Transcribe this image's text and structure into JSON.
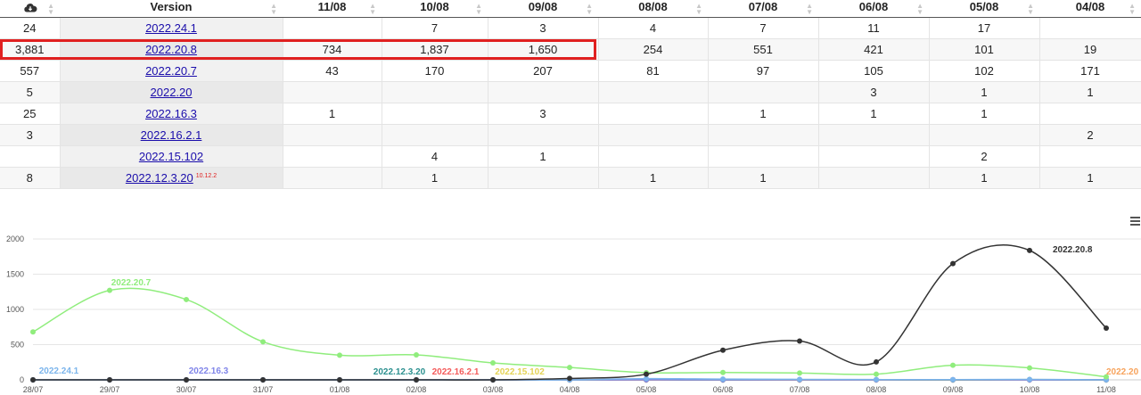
{
  "table": {
    "download_icon": "cloud-download-icon",
    "headers": [
      "Version",
      "11/08",
      "10/08",
      "09/08",
      "08/08",
      "07/08",
      "06/08",
      "05/08",
      "04/08"
    ],
    "rows": [
      {
        "total": "24",
        "version": "2022.24.1",
        "sup": "",
        "cells": [
          "",
          "7",
          "3",
          "4",
          "7",
          "11",
          "17",
          ""
        ]
      },
      {
        "total": "3,881",
        "version": "2022.20.8",
        "sup": "",
        "cells": [
          "734",
          "1,837",
          "1,650",
          "254",
          "551",
          "421",
          "101",
          "19"
        ]
      },
      {
        "total": "557",
        "version": "2022.20.7",
        "sup": "",
        "cells": [
          "43",
          "170",
          "207",
          "81",
          "97",
          "105",
          "102",
          "171"
        ]
      },
      {
        "total": "5",
        "version": "2022.20",
        "sup": "",
        "cells": [
          "",
          "",
          "",
          "",
          "",
          "3",
          "1",
          "1"
        ]
      },
      {
        "total": "25",
        "version": "2022.16.3",
        "sup": "",
        "cells": [
          "1",
          "",
          "3",
          "",
          "1",
          "1",
          "1",
          ""
        ]
      },
      {
        "total": "3",
        "version": "2022.16.2.1",
        "sup": "",
        "cells": [
          "",
          "",
          "",
          "",
          "",
          "",
          "",
          "2"
        ]
      },
      {
        "total": "",
        "version": "2022.15.102",
        "sup": "",
        "cells": [
          "",
          "4",
          "1",
          "",
          "",
          "",
          "2",
          ""
        ]
      },
      {
        "total": "8",
        "version": "2022.12.3.20",
        "sup": "10.12.2",
        "cells": [
          "",
          "1",
          "",
          "1",
          "1",
          "",
          "1",
          "1"
        ]
      }
    ],
    "highlighted_row": "2022.20.8"
  },
  "chart_menu_icon": "hamburger-menu-icon",
  "chart_data": {
    "type": "line",
    "x": [
      "28/07",
      "29/07",
      "30/07",
      "31/07",
      "01/08",
      "02/08",
      "03/08",
      "04/08",
      "05/08",
      "06/08",
      "07/08",
      "08/08",
      "09/08",
      "10/08",
      "11/08"
    ],
    "ylim": [
      0,
      2000
    ],
    "yticks": [
      0,
      500,
      1000,
      1500,
      2000
    ],
    "grid": true,
    "series": [
      {
        "name": "2022.20.8",
        "color": "#333333",
        "values": [
          0,
          0,
          0,
          0,
          0,
          0,
          0,
          20,
          80,
          421,
          551,
          254,
          1650,
          1837,
          734
        ]
      },
      {
        "name": "2022.20.7",
        "color": "#90ed7d",
        "values": [
          680,
          1270,
          1140,
          540,
          350,
          355,
          240,
          175,
          102,
          105,
          97,
          81,
          207,
          170,
          43
        ]
      },
      {
        "name": "2022.24.1",
        "color": "#7cb5ec",
        "values": [
          0,
          0,
          0,
          0,
          0,
          0,
          0,
          0,
          17,
          11,
          7,
          4,
          3,
          7,
          0
        ]
      },
      {
        "name": "2022.16.3",
        "color": "#8085e9",
        "values": [
          0,
          0,
          0,
          0,
          0,
          0,
          0,
          0,
          1,
          1,
          1,
          0,
          3,
          0,
          1
        ]
      },
      {
        "name": "2022.12.3.20",
        "color": "#2b908f",
        "values": [
          0,
          0,
          0,
          0,
          0,
          0,
          0,
          0,
          1,
          0,
          1,
          1,
          0,
          1,
          0
        ]
      },
      {
        "name": "2022.16.2.1",
        "color": "#f45b5b",
        "values": [
          0,
          0,
          0,
          0,
          0,
          0,
          0,
          0,
          0,
          0,
          0,
          0,
          0,
          0,
          0
        ]
      },
      {
        "name": "2022.15.102",
        "color": "#e4d354",
        "values": [
          0,
          0,
          0,
          0,
          0,
          0,
          0,
          0,
          0,
          0,
          0,
          0,
          1,
          4,
          0
        ]
      },
      {
        "name": "2022.20",
        "color": "#f7a35c",
        "values": [
          0,
          0,
          0,
          0,
          0,
          0,
          0,
          0,
          1,
          3,
          0,
          0,
          0,
          0,
          0
        ]
      }
    ]
  }
}
